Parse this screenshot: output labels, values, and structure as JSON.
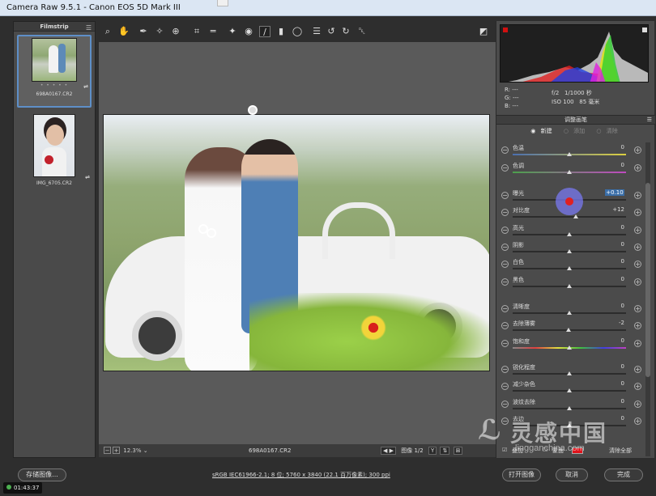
{
  "window": {
    "title": "Camera Raw 9.5.1 -  Canon EOS 5D Mark III"
  },
  "filmstrip": {
    "title": "Filmstrip",
    "items": [
      {
        "name": "698A0167.CR2",
        "rating": "• • • • •",
        "selected": true
      },
      {
        "name": "IMG_6705.CR2",
        "rating": "",
        "selected": false
      }
    ]
  },
  "toolbar": {
    "tools": [
      {
        "id": "zoom-tool",
        "glyph": "⌕"
      },
      {
        "id": "hand-tool",
        "glyph": "✋"
      },
      {
        "id": "white-balance-tool",
        "glyph": "✒"
      },
      {
        "id": "color-sampler-tool",
        "glyph": "✧"
      },
      {
        "id": "targeted-adjustment-tool",
        "glyph": "⊕"
      },
      {
        "id": "crop-tool",
        "glyph": "⌗"
      },
      {
        "id": "straighten-tool",
        "glyph": "═"
      },
      {
        "id": "spot-removal-tool",
        "glyph": "✦"
      },
      {
        "id": "red-eye-tool",
        "glyph": "◉"
      },
      {
        "id": "adjustment-brush-tool",
        "glyph": "∕"
      },
      {
        "id": "graduated-filter-tool",
        "glyph": "▮"
      },
      {
        "id": "radial-filter-tool",
        "glyph": "◯"
      },
      {
        "id": "preferences-tool",
        "glyph": "☰"
      },
      {
        "id": "rotate-left-tool",
        "glyph": "↺"
      },
      {
        "id": "rotate-right-tool",
        "glyph": "↻"
      },
      {
        "id": "trash-tool",
        "glyph": "␡"
      }
    ],
    "fullscreen_glyph": "◩"
  },
  "histogram": {
    "rgb": {
      "r": "R:  ---",
      "g": "G:  ---",
      "b": "B:  ---"
    },
    "aperture": "f/2",
    "shutter": "1/1000 秒",
    "iso": "ISO 100",
    "focal": "85 毫米"
  },
  "panel": {
    "title": "调整画笔",
    "modes": [
      {
        "label": "新建",
        "on": true
      },
      {
        "label": "添加",
        "on": false
      },
      {
        "label": "清除",
        "on": false
      }
    ],
    "sliders": [
      {
        "label": "色温",
        "value": "0",
        "pos": 0.5,
        "track": "temp"
      },
      {
        "label": "色调",
        "value": "0",
        "pos": 0.5,
        "track": "tint"
      },
      {
        "label": "曝光",
        "value": "+0.10",
        "pos": 0.51,
        "track": "",
        "highlight": true
      },
      {
        "label": "对比度",
        "value": "+12",
        "pos": 0.56,
        "track": ""
      },
      {
        "label": "高光",
        "value": "0",
        "pos": 0.5,
        "track": ""
      },
      {
        "label": "阴影",
        "value": "0",
        "pos": 0.5,
        "track": ""
      },
      {
        "label": "白色",
        "value": "0",
        "pos": 0.5,
        "track": ""
      },
      {
        "label": "黑色",
        "value": "0",
        "pos": 0.5,
        "track": ""
      },
      {
        "label": "清晰度",
        "value": "0",
        "pos": 0.5,
        "track": ""
      },
      {
        "label": "去除薄雾",
        "value": "-2",
        "pos": 0.49,
        "track": ""
      },
      {
        "label": "饱和度",
        "value": "0",
        "pos": 0.5,
        "track": "sat"
      },
      {
        "label": "锐化程度",
        "value": "0",
        "pos": 0.5,
        "track": ""
      },
      {
        "label": "减少杂色",
        "value": "0",
        "pos": 0.5,
        "track": ""
      },
      {
        "label": "波纹去除",
        "value": "0",
        "pos": 0.5,
        "track": ""
      },
      {
        "label": "去边",
        "value": "0",
        "pos": 0.5,
        "track": ""
      }
    ],
    "overlay_label": "叠加",
    "mask_label": "蒙面",
    "mask_color": "#e0141c",
    "clear_all": "清除全部"
  },
  "bottom": {
    "zoom": "12.3%",
    "filename": "698A0167.CR2",
    "image_counter": "图像 1/2",
    "view_y": "Y"
  },
  "footer": {
    "save": "存储图像...",
    "workflow": "sRGB IEC61966-2.1; 8 位; 5760 x 3840 (22.1 百万像素); 300 ppi",
    "open": "打开图像",
    "cancel": "取消",
    "done": "完成"
  },
  "timer": "01:43:37",
  "watermark": {
    "brand": "灵感中国",
    "url": "lingganchina.com"
  }
}
